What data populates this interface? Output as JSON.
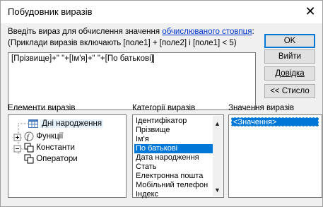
{
  "window": {
    "title": "Побудовник виразів",
    "close_glyph": "✕"
  },
  "prompt": {
    "line1_prefix": "Введіть вираз для обчислення значення ",
    "line1_link": "обчислюваного стовпця",
    "line1_suffix": ":",
    "line2": "(Приклади виразів включають [поле1] + [поле2] і [поле1] < 5)"
  },
  "expression": {
    "value": "[Прізвище]+\" \"+[Ім'я]+\" \"+[По батькові]"
  },
  "buttons": {
    "ok": "OK",
    "cancel": "Вийти",
    "help": "Довідка",
    "less": "<< Стисло"
  },
  "panels": {
    "elements": {
      "label": "Елементи виразів",
      "items": [
        {
          "label": "Дні народження",
          "icon": "table-icon",
          "selected": true
        },
        {
          "label": "Функції",
          "icon": "function-icon"
        },
        {
          "label": "Константи",
          "icon": "constants-icon"
        },
        {
          "label": "Оператори",
          "icon": "operators-icon"
        }
      ]
    },
    "categories": {
      "label": "Категорії виразів",
      "items": [
        "Ідентифікатор",
        "Прізвище",
        "Ім'я",
        "По батькові",
        "Дата народження",
        "Стать",
        "Електронна пошта",
        "Мобільний телефон",
        "Індекс"
      ],
      "selected_index": 3
    },
    "values": {
      "label": "Значення виразів",
      "items": [
        "<Значення>"
      ]
    }
  },
  "colors": {
    "selection": "#0078d7",
    "link": "#0033cc"
  }
}
